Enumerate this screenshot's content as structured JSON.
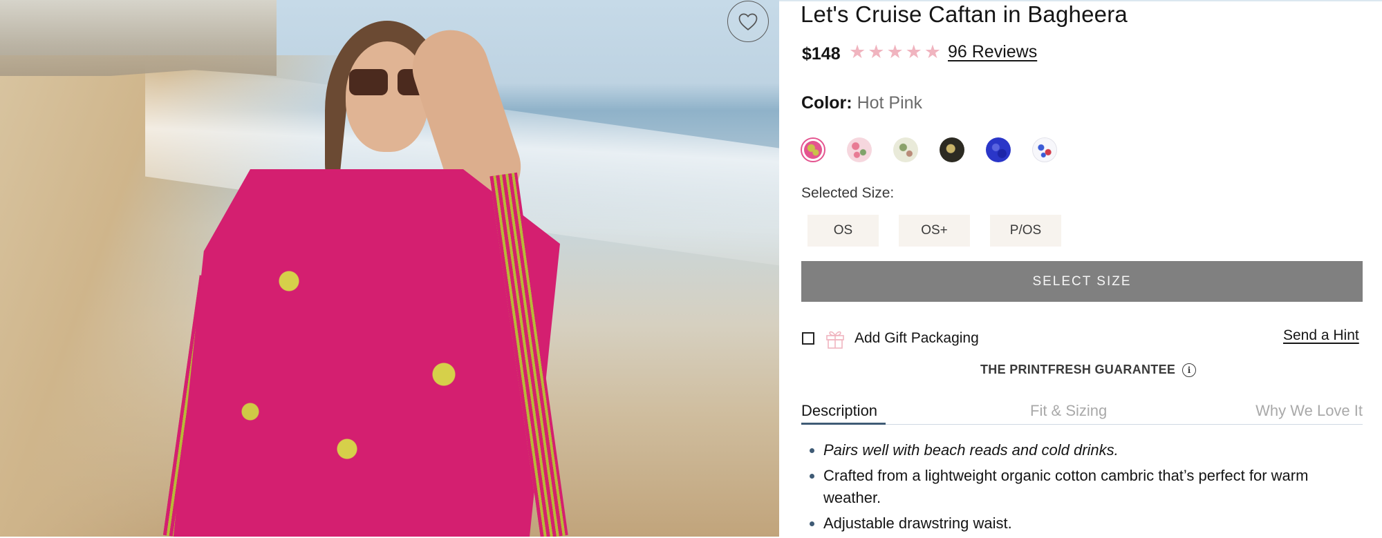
{
  "product": {
    "title": "Let's Cruise Caftan in Bagheera",
    "price": "$148",
    "rating_stars": 5,
    "reviews_label": "96 Reviews"
  },
  "color": {
    "label": "Color:",
    "value": "Hot Pink",
    "swatches": [
      {
        "name": "Hot Pink",
        "selected": true,
        "color": "#e4548f"
      },
      {
        "name": "Pink Floral",
        "selected": false,
        "color": "#f3c0cc"
      },
      {
        "name": "Cream Green",
        "selected": false,
        "color": "#dfe3cf"
      },
      {
        "name": "Black Gold",
        "selected": false,
        "color": "#2c2a22"
      },
      {
        "name": "Blue",
        "selected": false,
        "color": "#2a36c8"
      },
      {
        "name": "White Blue Red",
        "selected": false,
        "color": "#f2f2f8"
      }
    ]
  },
  "size": {
    "label": "Selected Size:",
    "options": [
      "OS",
      "OS+",
      "P/OS"
    ],
    "cta": "SELECT SIZE"
  },
  "gift": {
    "label": "Add Gift Packaging",
    "hint_link": "Send a Hint"
  },
  "guarantee": {
    "label": "THE PRINTFRESH GUARANTEE"
  },
  "tabs": [
    {
      "label": "Description",
      "active": true
    },
    {
      "label": "Fit & Sizing",
      "active": false
    },
    {
      "label": "Why We Love It",
      "active": false
    }
  ],
  "description": [
    "Pairs well with beach reads and cold drinks.",
    "Crafted from a lightweight organic cotton cambric that’s perfect for warm weather.",
    "Adjustable drawstring waist."
  ],
  "icons": {
    "favorite": "heart-icon",
    "star": "star-icon",
    "gift": "gift-icon",
    "info": "info-icon"
  },
  "colors": {
    "star": "#f0b4bf",
    "button_gray": "#808080",
    "tab_accent": "#3f5b75",
    "swatch_selected_ring": "#e4548f"
  }
}
